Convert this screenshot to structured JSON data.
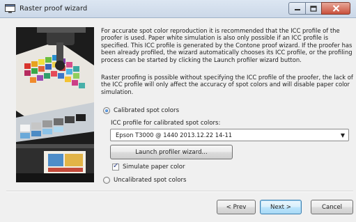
{
  "window": {
    "title": "Raster proof wizard"
  },
  "content": {
    "paragraph1": "For accurate spot color reproduction it is recommended that the ICC profile of the proofer is used. Paper white simulation is also only possible if an ICC profile is specified. This ICC profile is generated by the Contone proof wizard. If the proofer has been already profiled, the wizard automatically chooses its ICC profile, or the profiling process can be started by clicking the Launch profiler wizard button.",
    "paragraph2": "Raster proofing is possible without specifying the ICC profile of the proofer, the lack of the ICC profile will only affect the accuracy of spot colors and will disable paper color simulation."
  },
  "options": {
    "calibrated_label": "Calibrated spot colors",
    "calibrated_selected": true,
    "icc_label": "ICC profile for calibrated spot colors:",
    "icc_value": "Epson T3000 @ 1440 2013.12.22 14-11",
    "launch_button": "Launch profiler wizard...",
    "simulate_label": "Simulate paper color",
    "simulate_checked": true,
    "uncalibrated_label": "Uncalibrated spot colors",
    "uncalibrated_selected": false
  },
  "footer": {
    "prev_label": "< Prev",
    "next_label": "Next >",
    "cancel_label": "Cancel"
  },
  "colors": {
    "accent": "#3c7fb1",
    "titlebar": "#dce6f2"
  }
}
